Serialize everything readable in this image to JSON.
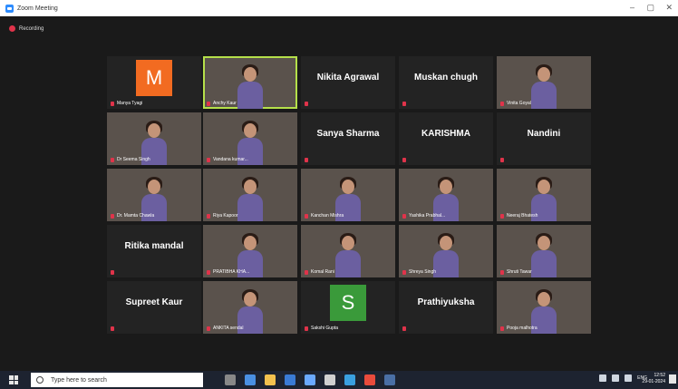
{
  "window": {
    "title": "Zoom Meeting"
  },
  "recording": {
    "label": "Recording"
  },
  "tiles": [
    {
      "id": "manya",
      "big": "",
      "small": "Manya Tyagi",
      "avatar": "M",
      "avatar_color": "#f26b21"
    },
    {
      "id": "anchy",
      "big": "",
      "small": "Anchy Kaur",
      "video": true,
      "active": true
    },
    {
      "id": "nikita",
      "big": "Nikita Agrawal",
      "small": ""
    },
    {
      "id": "muskan",
      "big": "Muskan chugh",
      "small": ""
    },
    {
      "id": "vinita",
      "big": "",
      "small": "Vinita Goyal",
      "video": true
    },
    {
      "id": "seema",
      "big": "",
      "small": "Dr Seema Singh",
      "video": true
    },
    {
      "id": "vandana",
      "big": "",
      "small": "Vandana kumar...",
      "video": true
    },
    {
      "id": "sanya",
      "big": "Sanya Sharma",
      "small": ""
    },
    {
      "id": "karishma",
      "big": "KARISHMA",
      "small": ""
    },
    {
      "id": "nandini",
      "big": "Nandini",
      "small": ""
    },
    {
      "id": "mamta",
      "big": "",
      "small": "Dr. Mamta Chawla",
      "video": true
    },
    {
      "id": "riya",
      "big": "",
      "small": "Riya Kapoor",
      "video": true
    },
    {
      "id": "kanchan",
      "big": "",
      "small": "Kanchan Mishra",
      "video": true
    },
    {
      "id": "yashika",
      "big": "",
      "small": "Yashika Prabhal...",
      "video": true
    },
    {
      "id": "neeraj",
      "big": "",
      "small": "Neeraj Bhatesh",
      "video": true
    },
    {
      "id": "ritika",
      "big": "Ritika mandal",
      "small": ""
    },
    {
      "id": "pratibha",
      "big": "",
      "small": "PRATIBHA KHA...",
      "video": true
    },
    {
      "id": "komal",
      "big": "",
      "small": "Komal Rani",
      "video": true
    },
    {
      "id": "shreya",
      "big": "",
      "small": "Shreya Singh",
      "video": true
    },
    {
      "id": "shruti",
      "big": "",
      "small": "Shruti Tawar",
      "video": true
    },
    {
      "id": "supreet",
      "big": "Supreet Kaur",
      "small": ""
    },
    {
      "id": "ankita",
      "big": "",
      "small": "ANKITA sendal",
      "video": true
    },
    {
      "id": "sakshi",
      "big": "",
      "small": "Sakshi Gupta",
      "avatar": "S",
      "avatar_color": "#3a9a3a"
    },
    {
      "id": "prathiyuksha",
      "big": "Prathiyuksha",
      "small": ""
    },
    {
      "id": "pooja",
      "big": "",
      "small": "Pooja malhotra",
      "video": true
    }
  ],
  "taskbar": {
    "search_placeholder": "Type here to search",
    "lang": "ENG",
    "time": "12:52",
    "date": "29-01-2024"
  }
}
